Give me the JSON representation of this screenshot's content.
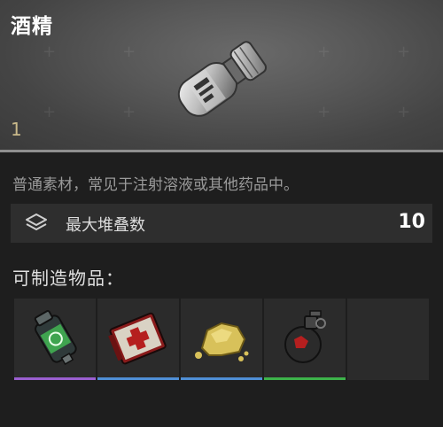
{
  "item": {
    "name": "酒精",
    "quantity": "1",
    "description": "普通素材，常见于注射溶液或其他药品中。",
    "image_icon": "alcohol-vial-icon"
  },
  "stack": {
    "icon": "layers-icon",
    "label": "最大堆叠数",
    "value": "10"
  },
  "craftable": {
    "label": "可制造物品：",
    "items": [
      {
        "icon": "stim-injector-icon",
        "rarity_color": "#9a5fd0"
      },
      {
        "icon": "medkit-icon",
        "rarity_color": "#4f8fd6"
      },
      {
        "icon": "gold-nugget-icon",
        "rarity_color": "#4f8fd6"
      },
      {
        "icon": "red-grenade-icon",
        "rarity_color": "#3db34a"
      },
      {
        "icon": "",
        "rarity_color": "#2b2b2b"
      }
    ]
  },
  "colors": {
    "background": "#1e1e1e",
    "header": "#585858",
    "row": "#2e2e2e",
    "quantity": "#c9b98a"
  }
}
